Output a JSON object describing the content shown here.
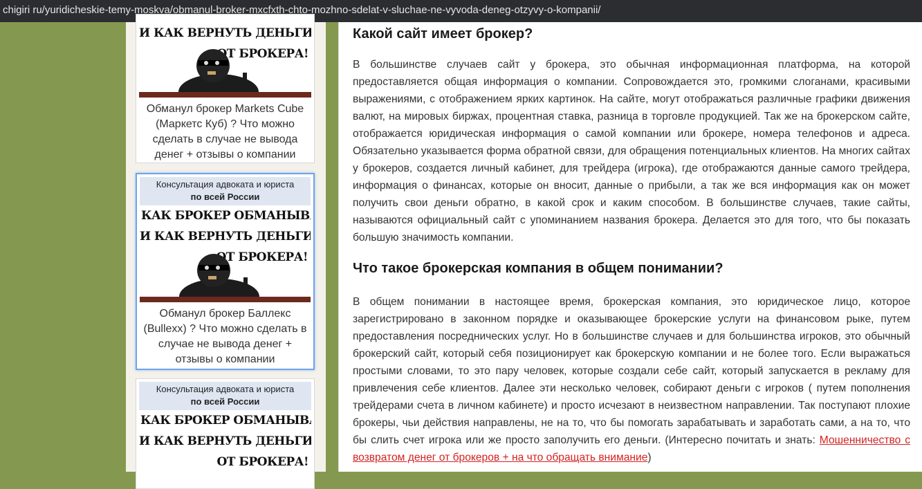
{
  "browser": {
    "url": "chigiri ru/yuridicheskie-temy-moskva/obmanul-broker-mxcfxth-chto-mozhno-sdelat-v-sluchae-ne-vyvoda-deneg-otzyvy-o-kompanii/"
  },
  "sidebar": {
    "cards": [
      {
        "banner_lines": [
          "И КАК ВЕРНУТЬ ДЕНЬГИ",
          "ОТ БРОКЕРА!"
        ],
        "title": "Обманул брокер Markets Cube (Маркетс Куб) ? Что можно сделать в случае не вывода денег + отзывы о компании"
      },
      {
        "consult_line1": "Консультация адвоката и юриста",
        "consult_line2": "по всей России",
        "banner_lines": [
          "КАК БРОКЕР ОБМАНЫВАЕТ!",
          "И КАК ВЕРНУТЬ ДЕНЬГИ",
          "ОТ БРОКЕРА!"
        ],
        "title": "Обманул брокер Баллекс (Bullexx) ? Что можно сделать в случае не вывода денег + отзывы о компании"
      },
      {
        "consult_line1": "Консультация адвоката и юриста",
        "consult_line2": "по всей России",
        "banner_lines": [
          "КАК БРОКЕР ОБМАНЫВАЕТ!",
          "И КАК ВЕРНУТЬ ДЕНЬГИ",
          "ОТ БРОКЕРА!"
        ]
      }
    ]
  },
  "article": {
    "heading1": "Какой сайт имеет брокер?",
    "para1": "В большинстве случаев сайт у брокера, это обычная информационная платформа, на которой предоставляется общая информация о компании. Сопровождается это, громкими слоганами, красивыми выражениями, с отображением ярких картинок. На сайте, могут отображаться различные графики движения валют, на мировых биржах, процентная ставка, разница в торговле продукцией. Так же на брокерском сайте, отображается юридическая информация о самой компании или брокере, номера телефонов и адреса. Обязательно указывается форма обратной связи, для обращения потенциальных клиентов. На многих сайтах у брокеров, создается личный кабинет, для трейдера (игрока), где отображаются данные самого трейдера, информация о финансах, которые он вносит, данные о прибыли, а так же вся информация как он может получить свои деньги обратно, в какой срок и каким способом. В большинстве случаев, такие сайты, называются официальный сайт с упоминанием названия брокера. Делается это для того, что бы показать большую значимость компании.",
    "heading2": "Что такое брокерская компания в общем понимании?",
    "para2": "В общем понимании в настоящее время, брокерская компания, это юридическое лицо, которое зарегистрировано в законном порядке и оказывающее брокерские услуги на финансовом рыке, путем предоставления посреднических услуг. Но в большинстве случаев и для большинства игроков, это обычный брокерский сайт, который себя позиционирует как брокерскую компании и не более того. Если выражаться простыми словами, то это пару человек, которые создали себе сайт, который запускается в рекламу для привлечения себе клиентов. Далее эти несколько человек, собирают деньги с игроков ( путем пополнения трейдерами счета в личном кабинете) и просто исчезают в неизвестном направлении. Так поступают плохие брокеры, чьи действия направлены, не на то, что бы помогать зарабатывать и заработать сами, а на то, что бы слить счет игрока или же просто заполучить его деньги. (Интересно почитать и знать: ",
    "link_text": "Мошенничество с возвратом денег от брокеров + на что обращать внимание",
    "para2_end": ")"
  },
  "colors": {
    "background_green": "#84994f",
    "link_red": "#d32222",
    "active_border": "#6fa3e8"
  }
}
